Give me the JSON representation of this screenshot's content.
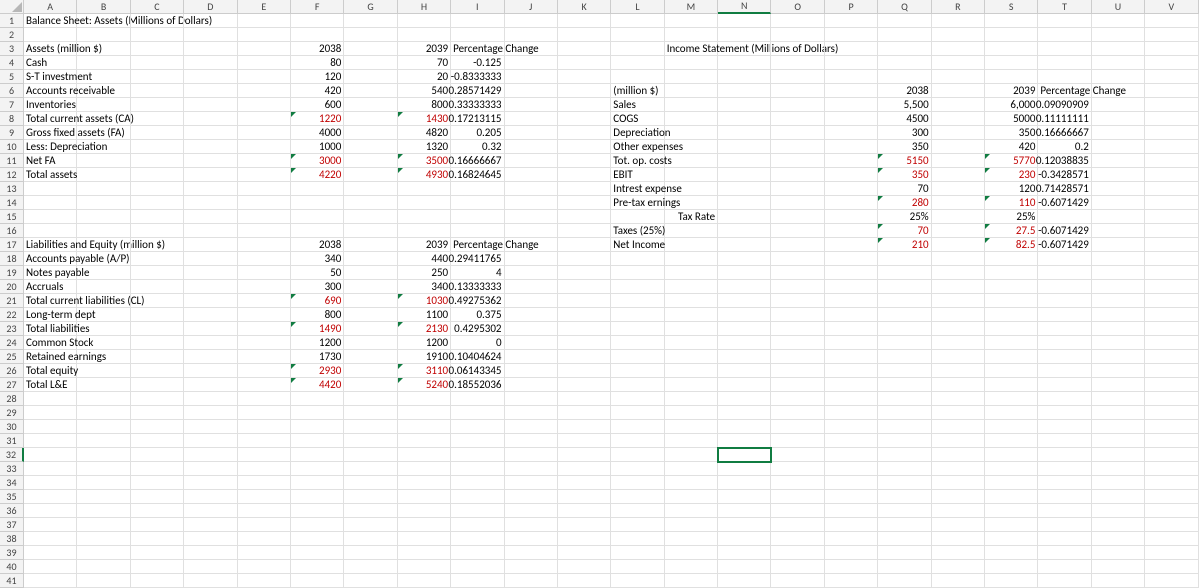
{
  "columns": [
    "A",
    "B",
    "C",
    "D",
    "E",
    "F",
    "G",
    "H",
    "I",
    "J",
    "K",
    "L",
    "M",
    "N",
    "O",
    "P",
    "Q",
    "R",
    "S",
    "T",
    "U",
    "V"
  ],
  "row_count": 41,
  "selected": {
    "col": "N",
    "row": 32
  },
  "cells": {
    "A1": {
      "v": "Balance Sheet: Assets (Millions of Dollars)"
    },
    "A3": {
      "v": "Assets (million $)"
    },
    "F3": {
      "v": "2038",
      "num": true
    },
    "H3": {
      "v": "2039",
      "num": true
    },
    "I3": {
      "v": "Percentage Change"
    },
    "M3": {
      "v": "Income Statement (Millions of Dollars)"
    },
    "A4": {
      "v": "Cash"
    },
    "F4": {
      "v": "80",
      "num": true
    },
    "H4": {
      "v": "70",
      "num": true
    },
    "I4": {
      "v": "-0.125",
      "num": true
    },
    "A5": {
      "v": "S-T investment"
    },
    "F5": {
      "v": "120",
      "num": true
    },
    "H5": {
      "v": "20",
      "num": true
    },
    "I5": {
      "v": "-0.8333333",
      "num": true
    },
    "A6": {
      "v": "Accounts receivable"
    },
    "F6": {
      "v": "420",
      "num": true
    },
    "H6": {
      "v": "540",
      "num": true
    },
    "I6": {
      "v": "0.28571429",
      "num": true
    },
    "L6": {
      "v": "(million $)"
    },
    "Q6": {
      "v": "2038",
      "num": true
    },
    "S6": {
      "v": "2039",
      "num": true
    },
    "T6": {
      "v": "Percentage Change"
    },
    "A7": {
      "v": "Inventories"
    },
    "F7": {
      "v": "600",
      "num": true
    },
    "H7": {
      "v": "800",
      "num": true
    },
    "I7": {
      "v": "0.33333333",
      "num": true
    },
    "L7": {
      "v": "Sales"
    },
    "Q7": {
      "v": "5,500",
      "num": true
    },
    "S7": {
      "v": "6,000",
      "num": true
    },
    "T7": {
      "v": "0.09090909",
      "num": true
    },
    "A8": {
      "v": "Total current assets (CA)"
    },
    "F8": {
      "v": "1220",
      "num": true,
      "red": true,
      "mark": true
    },
    "H8": {
      "v": "1430",
      "num": true,
      "red": true,
      "mark": true
    },
    "I8": {
      "v": "0.17213115",
      "num": true
    },
    "L8": {
      "v": "COGS"
    },
    "Q8": {
      "v": "4500",
      "num": true
    },
    "S8": {
      "v": "5000",
      "num": true
    },
    "T8": {
      "v": "0.11111111",
      "num": true
    },
    "A9": {
      "v": "Gross fixed assets (FA)"
    },
    "F9": {
      "v": "4000",
      "num": true
    },
    "H9": {
      "v": "4820",
      "num": true
    },
    "I9": {
      "v": "0.205",
      "num": true
    },
    "L9": {
      "v": "Depreciation"
    },
    "Q9": {
      "v": "300",
      "num": true
    },
    "S9": {
      "v": "350",
      "num": true
    },
    "T9": {
      "v": "0.16666667",
      "num": true
    },
    "A10": {
      "v": "Less: Depreciation"
    },
    "F10": {
      "v": "1000",
      "num": true
    },
    "H10": {
      "v": "1320",
      "num": true
    },
    "I10": {
      "v": "0.32",
      "num": true
    },
    "L10": {
      "v": "Other expenses"
    },
    "Q10": {
      "v": "350",
      "num": true
    },
    "S10": {
      "v": "420",
      "num": true
    },
    "T10": {
      "v": "0.2",
      "num": true
    },
    "A11": {
      "v": "Net FA"
    },
    "F11": {
      "v": "3000",
      "num": true,
      "red": true,
      "mark": true
    },
    "H11": {
      "v": "3500",
      "num": true,
      "red": true,
      "mark": true
    },
    "I11": {
      "v": "0.16666667",
      "num": true
    },
    "L11": {
      "v": "Tot. op. costs"
    },
    "Q11": {
      "v": "5150",
      "num": true,
      "red": true,
      "mark": true
    },
    "S11": {
      "v": "5770",
      "num": true,
      "red": true,
      "mark": true
    },
    "T11": {
      "v": "0.12038835",
      "num": true
    },
    "A12": {
      "v": "Total assets"
    },
    "F12": {
      "v": "4220",
      "num": true,
      "red": true,
      "mark": true
    },
    "H12": {
      "v": "4930",
      "num": true,
      "red": true,
      "mark": true
    },
    "I12": {
      "v": "0.16824645",
      "num": true
    },
    "L12": {
      "v": "EBIT"
    },
    "Q12": {
      "v": "350",
      "num": true,
      "red": true,
      "mark": true
    },
    "S12": {
      "v": "230",
      "num": true,
      "red": true,
      "mark": true
    },
    "T12": {
      "v": "-0.3428571",
      "num": true
    },
    "L13": {
      "v": "Intrest expense"
    },
    "Q13": {
      "v": "70",
      "num": true
    },
    "S13": {
      "v": "120",
      "num": true
    },
    "T13": {
      "v": "0.71428571",
      "num": true
    },
    "L14": {
      "v": "Pre-tax ernings"
    },
    "Q14": {
      "v": "280",
      "num": true,
      "red": true,
      "mark": true
    },
    "S14": {
      "v": "110",
      "num": true,
      "red": true,
      "mark": true
    },
    "T14": {
      "v": "-0.6071429",
      "num": true
    },
    "M15": {
      "v": "Tax Rate",
      "num": true
    },
    "Q15": {
      "v": "25%",
      "num": true
    },
    "S15": {
      "v": "25%",
      "num": true
    },
    "L16": {
      "v": "Taxes (25%)"
    },
    "Q16": {
      "v": "70",
      "num": true,
      "red": true,
      "mark": true
    },
    "S16": {
      "v": "27.5",
      "num": true,
      "red": true,
      "mark": true
    },
    "T16": {
      "v": "-0.6071429",
      "num": true
    },
    "A17": {
      "v": "Liabilities and Equity (million $)"
    },
    "F17": {
      "v": "2038",
      "num": true
    },
    "H17": {
      "v": "2039",
      "num": true
    },
    "I17": {
      "v": "Percentage Change"
    },
    "L17": {
      "v": "Net Income"
    },
    "Q17": {
      "v": "210",
      "num": true,
      "red": true,
      "mark": true
    },
    "S17": {
      "v": "82.5",
      "num": true,
      "red": true,
      "mark": true
    },
    "T17": {
      "v": "-0.6071429",
      "num": true
    },
    "A18": {
      "v": "Accounts payable (A/P)"
    },
    "F18": {
      "v": "340",
      "num": true
    },
    "H18": {
      "v": "440",
      "num": true
    },
    "I18": {
      "v": "0.29411765",
      "num": true
    },
    "A19": {
      "v": "Notes payable"
    },
    "F19": {
      "v": "50",
      "num": true
    },
    "H19": {
      "v": "250",
      "num": true
    },
    "I19": {
      "v": "4",
      "num": true
    },
    "A20": {
      "v": "Accruals"
    },
    "F20": {
      "v": "300",
      "num": true
    },
    "H20": {
      "v": "340",
      "num": true
    },
    "I20": {
      "v": "0.13333333",
      "num": true
    },
    "A21": {
      "v": "Total current liabilities (CL)"
    },
    "F21": {
      "v": "690",
      "num": true,
      "red": true,
      "mark": true
    },
    "H21": {
      "v": "1030",
      "num": true,
      "red": true,
      "mark": true
    },
    "I21": {
      "v": "0.49275362",
      "num": true
    },
    "A22": {
      "v": "Long-term dept"
    },
    "F22": {
      "v": "800",
      "num": true
    },
    "H22": {
      "v": "1100",
      "num": true
    },
    "I22": {
      "v": "0.375",
      "num": true
    },
    "A23": {
      "v": "Total liabilities"
    },
    "F23": {
      "v": "1490",
      "num": true,
      "red": true,
      "mark": true
    },
    "H23": {
      "v": "2130",
      "num": true,
      "red": true,
      "mark": true
    },
    "I23": {
      "v": "0.4295302",
      "num": true
    },
    "A24": {
      "v": "Common Stock"
    },
    "F24": {
      "v": "1200",
      "num": true
    },
    "H24": {
      "v": "1200",
      "num": true
    },
    "I24": {
      "v": "0",
      "num": true
    },
    "A25": {
      "v": "Retained earnings"
    },
    "F25": {
      "v": "1730",
      "num": true
    },
    "H25": {
      "v": "1910",
      "num": true
    },
    "I25": {
      "v": "0.10404624",
      "num": true
    },
    "A26": {
      "v": "Total equity"
    },
    "F26": {
      "v": "2930",
      "num": true,
      "red": true,
      "mark": true
    },
    "H26": {
      "v": "3110",
      "num": true,
      "red": true,
      "mark": true
    },
    "I26": {
      "v": "0.06143345",
      "num": true
    },
    "A27": {
      "v": "Total L&E"
    },
    "F27": {
      "v": "4420",
      "num": true,
      "red": true,
      "mark": true
    },
    "H27": {
      "v": "5240",
      "num": true,
      "red": true,
      "mark": true
    },
    "I27": {
      "v": "0.18552036",
      "num": true
    }
  }
}
